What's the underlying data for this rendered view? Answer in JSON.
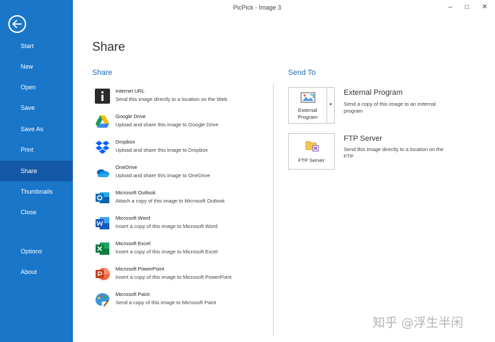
{
  "window": {
    "title": "PicPick - Image 3",
    "minimize": "–",
    "maximize": "□",
    "close": "✕"
  },
  "sidebar": {
    "back_icon": "back-arrow-icon",
    "items": [
      {
        "label": "Start"
      },
      {
        "label": "New"
      },
      {
        "label": "Open"
      },
      {
        "label": "Save"
      },
      {
        "label": "Save As"
      },
      {
        "label": "Print"
      },
      {
        "label": "Share",
        "active": true
      },
      {
        "label": "Thumbnails"
      },
      {
        "label": "Close"
      },
      {
        "label": "Options"
      },
      {
        "label": "About"
      }
    ]
  },
  "main": {
    "page_title": "Share",
    "share_heading": "Share",
    "send_heading": "Send To",
    "share_items": [
      {
        "name": "Internet URL",
        "desc": "Send this image directly to a location on the Web",
        "icon": "internet-url-icon"
      },
      {
        "name": "Google Drive",
        "desc": "Upload and share this image to Google Drive",
        "icon": "google-drive-icon"
      },
      {
        "name": "Dropbox",
        "desc": "Upload and share this image to Dropbox",
        "icon": "dropbox-icon"
      },
      {
        "name": "OneDrive",
        "desc": "Upload and share this image to OneDrive",
        "icon": "onedrive-icon"
      },
      {
        "name": "Microsoft Outlook",
        "desc": "Attach a copy of this image to Microsoft Outlook",
        "icon": "outlook-icon"
      },
      {
        "name": "Microsoft Word",
        "desc": "Insert a copy of this image to Microsoft Word",
        "icon": "word-icon"
      },
      {
        "name": "Microsoft Excel",
        "desc": "Insert a copy of this image to Microsoft Excel",
        "icon": "excel-icon"
      },
      {
        "name": "Microsoft PowerPoint",
        "desc": "Insert a copy of this image to Microsoft PowerPoint",
        "icon": "powerpoint-icon"
      },
      {
        "name": "Microsoft Paint",
        "desc": "Send a copy of this image to Microsoft Paint",
        "icon": "paint-icon"
      }
    ],
    "send_to": {
      "external": {
        "tile_line1": "External",
        "tile_line2": "Program",
        "title": "External Program",
        "desc": "Send a copy of this image to an external program",
        "dropdown": "▾"
      },
      "ftp": {
        "tile_label": "FTP Server",
        "title": "FTP Server",
        "desc": "Send this image directly to a location on the FTP"
      }
    }
  },
  "watermark": "知乎 @浮生半闲",
  "colors": {
    "sidebar": "#1976c9",
    "sidebar_active": "#1459a8",
    "heading_blue": "#1f6fb8"
  }
}
